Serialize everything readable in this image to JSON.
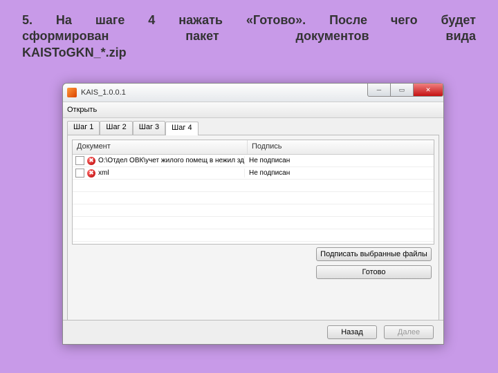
{
  "instruction": {
    "line1": "5. На шаге 4 нажать «Готово». После чего будет",
    "line2": "сформирован пакет документов вида",
    "line3": "KAISToGKN_*.zip"
  },
  "window": {
    "title": "KAIS_1.0.0.1",
    "menu": {
      "open": "Открыть"
    }
  },
  "tabs": {
    "items": [
      {
        "label": "Шаг 1"
      },
      {
        "label": "Шаг 2"
      },
      {
        "label": "Шаг 3"
      },
      {
        "label": "Шаг 4"
      }
    ],
    "activeIndex": 3
  },
  "grid": {
    "headers": {
      "doc": "Документ",
      "sig": "Подпись"
    },
    "rows": [
      {
        "doc": "O:\\Отдел ОВК\\учет жилого помещ в нежил здан...",
        "sig": "Не подписан"
      },
      {
        "doc": "xml",
        "sig": "Не подписан"
      }
    ]
  },
  "buttons": {
    "sign": "Подписать выбранные файлы",
    "done": "Готово",
    "back": "Назад",
    "next": "Далее"
  }
}
